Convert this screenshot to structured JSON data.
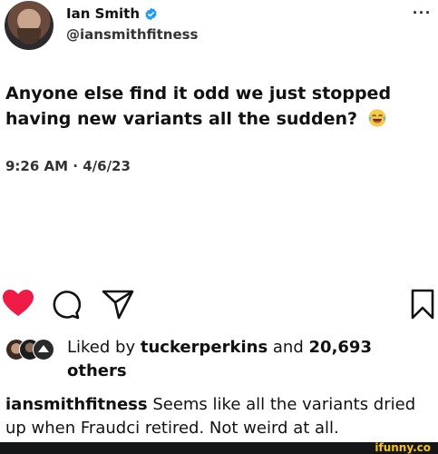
{
  "tweet": {
    "name": "Ian Smith",
    "handle": "@iansmithfitness",
    "text": "Anyone else find it odd we just stopped having new variants all the sudden?",
    "time": "9:26 AM · 4/6/23",
    "more_label": "···",
    "icons": {
      "avatar": "profile-photo",
      "verified": "verified-badge-icon",
      "emoji": "laughing-tears-emoji"
    },
    "colors": {
      "verified": "#1d9bf0"
    }
  },
  "post": {
    "actions": [
      {
        "name": "heart-icon",
        "liked": true,
        "color": "#ed1b46"
      },
      {
        "name": "comment-icon"
      },
      {
        "name": "share-icon"
      },
      {
        "name": "save-icon"
      }
    ],
    "likes": {
      "prefix": "Liked by",
      "user": "tuckerperkins",
      "joiner": "and",
      "count": "20,693",
      "suffix": "others"
    },
    "caption": {
      "user": "iansmithfitness",
      "text": "Seems like all the variants dried up when Fraudci retired. Not weird at all."
    }
  },
  "watermark": {
    "text": "ifunny.co",
    "color": "#f6c31b"
  }
}
